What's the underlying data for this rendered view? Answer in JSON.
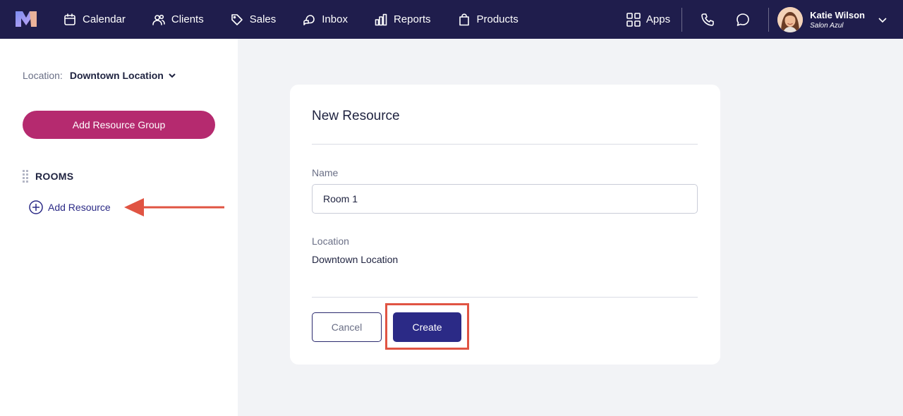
{
  "topbar": {
    "nav": [
      {
        "label": "Calendar",
        "icon": "calendar-icon"
      },
      {
        "label": "Clients",
        "icon": "users-icon"
      },
      {
        "label": "Sales",
        "icon": "tag-icon"
      },
      {
        "label": "Inbox",
        "icon": "inbox-icon"
      },
      {
        "label": "Reports",
        "icon": "bar-chart-icon"
      },
      {
        "label": "Products",
        "icon": "shopping-bag-icon"
      }
    ],
    "apps_label": "Apps",
    "user": {
      "name": "Katie Wilson",
      "salon": "Salon Azul"
    },
    "colors": {
      "background": "#1f1d4c"
    }
  },
  "sidebar": {
    "location_label": "Location:",
    "location_value": "Downtown Location",
    "add_group_label": "Add Resource Group",
    "group_title": "ROOMS",
    "add_resource_label": "Add Resource",
    "colors": {
      "primary_button": "#b52a6f",
      "link": "#2b2a86",
      "annotation": "#e05443"
    }
  },
  "card": {
    "title": "New Resource",
    "name_label": "Name",
    "name_value": "Room 1",
    "location_label": "Location",
    "location_value": "Downtown Location",
    "cancel_label": "Cancel",
    "create_label": "Create",
    "colors": {
      "create_button": "#2b2a86",
      "highlight": "#e05443"
    }
  }
}
